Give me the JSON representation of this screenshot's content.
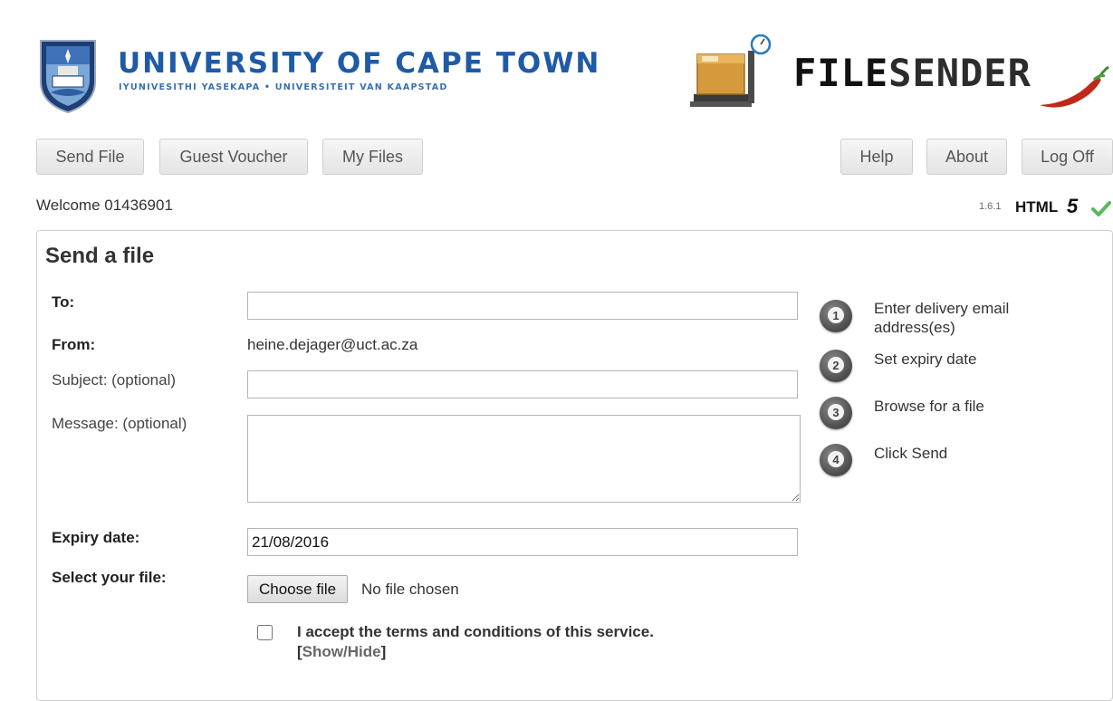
{
  "header": {
    "uct_name": "UNIVERSITY OF CAPE TOWN",
    "uct_subtitle": "IYUNIVESITHI YASEKAPA • UNIVERSITEIT VAN KAAPSTAD",
    "filesender_part1": "FILE",
    "filesender_part2": "SENDER",
    "crest_icon": "uct-crest-icon",
    "package_icon": "package-scale-icon",
    "chili_icon": "chili-pepper-icon"
  },
  "nav": {
    "send_file": "Send File",
    "guest_voucher": "Guest Voucher",
    "my_files": "My Files",
    "help": "Help",
    "about": "About",
    "log_off": "Log Off"
  },
  "status": {
    "welcome": "Welcome 01436901",
    "version": "1.6.1",
    "html_label": "HTML",
    "html_five": "5",
    "check_icon": "checkmark-icon"
  },
  "form": {
    "title": "Send a file",
    "to_label": "To:",
    "to_value": "",
    "from_label": "From:",
    "from_value": "heine.dejager@uct.ac.za",
    "subject_label": "Subject: (optional)",
    "subject_value": "",
    "message_label": "Message: (optional)",
    "message_value": "",
    "expiry_label": "Expiry date:",
    "expiry_value": "21/08/2016",
    "file_label": "Select your file:",
    "choose_file": "Choose file",
    "no_file": "No file chosen",
    "terms_text": "I accept the terms and conditions of this service.",
    "bracket_open": "[",
    "show_hide": "Show/Hide",
    "bracket_close": "]",
    "terms_checked": false
  },
  "steps": [
    {
      "num": "1",
      "text": "Enter delivery email address(es)"
    },
    {
      "num": "2",
      "text": "Set expiry date"
    },
    {
      "num": "3",
      "text": "Browse for a file"
    },
    {
      "num": "4",
      "text": "Click Send"
    }
  ],
  "colors": {
    "uct_blue": "#1f5aa6",
    "check_green": "#5cb85c",
    "chili_red": "#c0281a"
  }
}
